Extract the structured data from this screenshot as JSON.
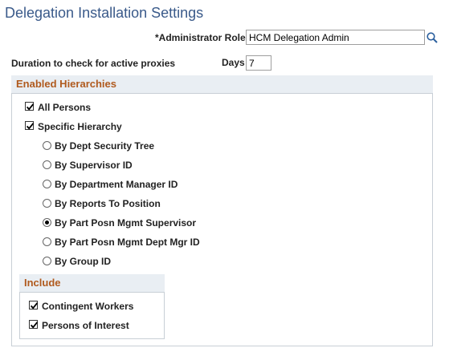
{
  "page": {
    "title": "Delegation Installation Settings"
  },
  "admin_role": {
    "label": "*Administrator Role",
    "value": "HCM Delegation Admin",
    "lookup_icon": "magnifier-icon"
  },
  "duration": {
    "label": "Duration to check for active proxies",
    "days_label": "Days",
    "days_value": "7"
  },
  "enabled_hierarchies": {
    "heading": "Enabled Hierarchies",
    "all_persons": {
      "label": "All Persons",
      "checked": true
    },
    "specific_hierarchy": {
      "label": "Specific Hierarchy",
      "checked": true
    },
    "options": [
      {
        "label": "By Dept Security Tree",
        "selected": false
      },
      {
        "label": "By Supervisor ID",
        "selected": false
      },
      {
        "label": "By Department Manager ID",
        "selected": false
      },
      {
        "label": "By Reports To Position",
        "selected": false
      },
      {
        "label": "By Part Posn Mgmt Supervisor",
        "selected": true
      },
      {
        "label": "By Part Posn Mgmt Dept Mgr ID",
        "selected": false
      },
      {
        "label": "By Group ID",
        "selected": false
      }
    ]
  },
  "include": {
    "heading": "Include",
    "items": [
      {
        "label": "Contingent Workers",
        "checked": true
      },
      {
        "label": "Persons of Interest",
        "checked": true
      }
    ]
  }
}
